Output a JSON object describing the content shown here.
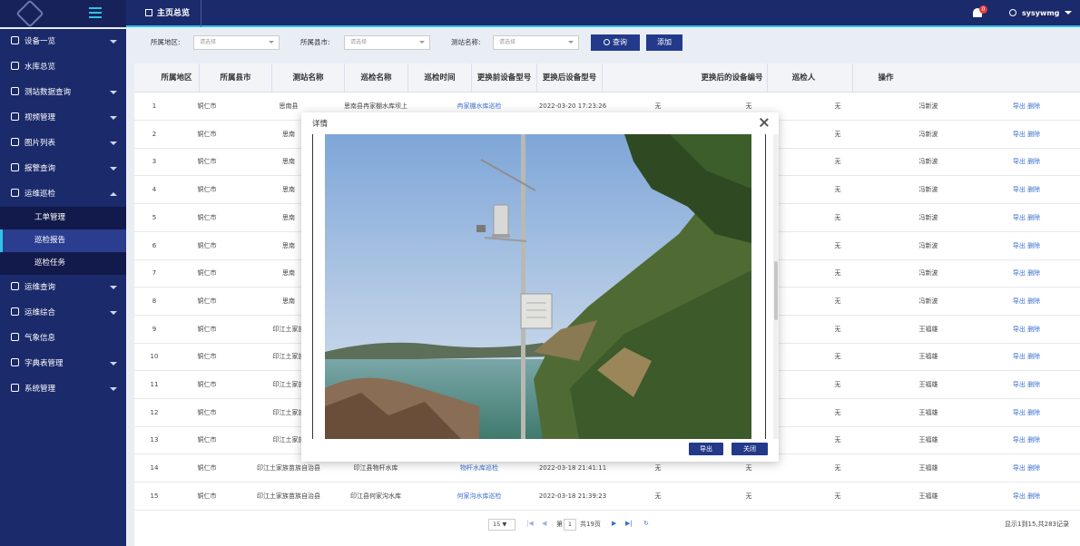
{
  "topbar": {
    "home_tab": "主页总览",
    "bell_count": "0",
    "username": "sysywmg"
  },
  "sidebar": {
    "items": [
      {
        "label": "设备一览",
        "arrow": "down"
      },
      {
        "label": "水库总览",
        "arrow": ""
      },
      {
        "label": "测站数据查询",
        "arrow": "down"
      },
      {
        "label": "视频管理",
        "arrow": "down"
      },
      {
        "label": "图片列表",
        "arrow": "down"
      },
      {
        "label": "报警查询",
        "arrow": "down"
      },
      {
        "label": "运维巡检",
        "arrow": "up"
      }
    ],
    "sub_items": [
      "工单管理",
      "巡检报告",
      "巡检任务"
    ],
    "items_after": [
      {
        "label": "运维查询",
        "arrow": "down"
      },
      {
        "label": "运维综合",
        "arrow": "down"
      },
      {
        "label": "气象信息",
        "arrow": ""
      },
      {
        "label": "字典表管理",
        "arrow": "down"
      },
      {
        "label": "系统管理",
        "arrow": "down"
      }
    ]
  },
  "filters": {
    "region_label": "所属地区:",
    "region_placeholder": "请选择",
    "county_label": "所属县市:",
    "county_placeholder": "请选择",
    "station_label": "测站名称:",
    "station_placeholder": "请选择",
    "query_button": "查询",
    "add_button": "添加"
  },
  "table": {
    "headers": [
      "所属地区",
      "所属县市",
      "测站名称",
      "巡检名称",
      "巡检时间",
      "更换前设备型号",
      "更换后设备型号",
      "更换后的设备编号",
      "巡检人",
      "操作"
    ],
    "rows": [
      {
        "no": "1",
        "region": "铜仁市",
        "county": "思南县",
        "station": "思南县冉家棚水库坝上",
        "name": "冉家棚水库巡检",
        "time": "2022-03-20 17:23:26",
        "before": "无",
        "after": "无",
        "code": "无",
        "person": "冯新波"
      },
      {
        "no": "2",
        "region": "铜仁市",
        "county": "思南",
        "station": "",
        "name": "",
        "time": "",
        "before": "",
        "after": "",
        "code": "无",
        "person": "冯新波"
      },
      {
        "no": "3",
        "region": "铜仁市",
        "county": "思南",
        "station": "",
        "name": "",
        "time": "",
        "before": "",
        "after": "",
        "code": "无",
        "person": "冯新波"
      },
      {
        "no": "4",
        "region": "铜仁市",
        "county": "思南",
        "station": "",
        "name": "",
        "time": "",
        "before": "",
        "after": "",
        "code": "无",
        "person": "冯新波"
      },
      {
        "no": "5",
        "region": "铜仁市",
        "county": "思南",
        "station": "",
        "name": "",
        "time": "",
        "before": "",
        "after": "",
        "code": "无",
        "person": "冯新波"
      },
      {
        "no": "6",
        "region": "铜仁市",
        "county": "思南",
        "station": "",
        "name": "",
        "time": "",
        "before": "",
        "after": "",
        "code": "无",
        "person": "冯新波"
      },
      {
        "no": "7",
        "region": "铜仁市",
        "county": "思南",
        "station": "",
        "name": "",
        "time": "",
        "before": "",
        "after": "",
        "code": "无",
        "person": "冯新波"
      },
      {
        "no": "8",
        "region": "铜仁市",
        "county": "思南",
        "station": "",
        "name": "",
        "time": "",
        "before": "",
        "after": "",
        "code": "无",
        "person": "冯新波"
      },
      {
        "no": "9",
        "region": "铜仁市",
        "county": "印江土家族",
        "station": "",
        "name": "",
        "time": "",
        "before": "",
        "after": "",
        "code": "无",
        "person": "王福雄"
      },
      {
        "no": "10",
        "region": "铜仁市",
        "county": "印江土家族",
        "station": "",
        "name": "",
        "time": "",
        "before": "",
        "after": "",
        "code": "无",
        "person": "王福雄"
      },
      {
        "no": "11",
        "region": "铜仁市",
        "county": "印江土家族",
        "station": "",
        "name": "",
        "time": "",
        "before": "",
        "after": "",
        "code": "无",
        "person": "王福雄"
      },
      {
        "no": "12",
        "region": "铜仁市",
        "county": "印江土家族",
        "station": "",
        "name": "",
        "time": "",
        "before": "",
        "after": "",
        "code": "无",
        "person": "王福雄"
      },
      {
        "no": "13",
        "region": "铜仁市",
        "county": "印江土家族",
        "station": "",
        "name": "",
        "time": "",
        "before": "",
        "after": "",
        "code": "无",
        "person": "王福雄"
      },
      {
        "no": "14",
        "region": "铜仁市",
        "county": "印江土家族苗族自治县",
        "station": "印江县物杆水库",
        "name": "物杆水库巡检",
        "time": "2022-03-18 21:41:11",
        "before": "无",
        "after": "无",
        "code": "无",
        "person": "王福雄"
      },
      {
        "no": "15",
        "region": "铜仁市",
        "county": "印江土家族苗族自治县",
        "station": "印江县何家沟水库",
        "name": "何家沟水库巡检",
        "time": "2022-03-18 21:39:23",
        "before": "无",
        "after": "无",
        "code": "无",
        "person": "王福雄"
      }
    ],
    "export_label": "导出",
    "delete_label": "删除"
  },
  "pager": {
    "page_size": "15",
    "page_prefix": "第",
    "page": "1",
    "total_pages": "共19页",
    "summary": "显示1到15,共283记录"
  },
  "modal": {
    "title": "详情",
    "export_button": "导出",
    "close_button": "关闭"
  }
}
